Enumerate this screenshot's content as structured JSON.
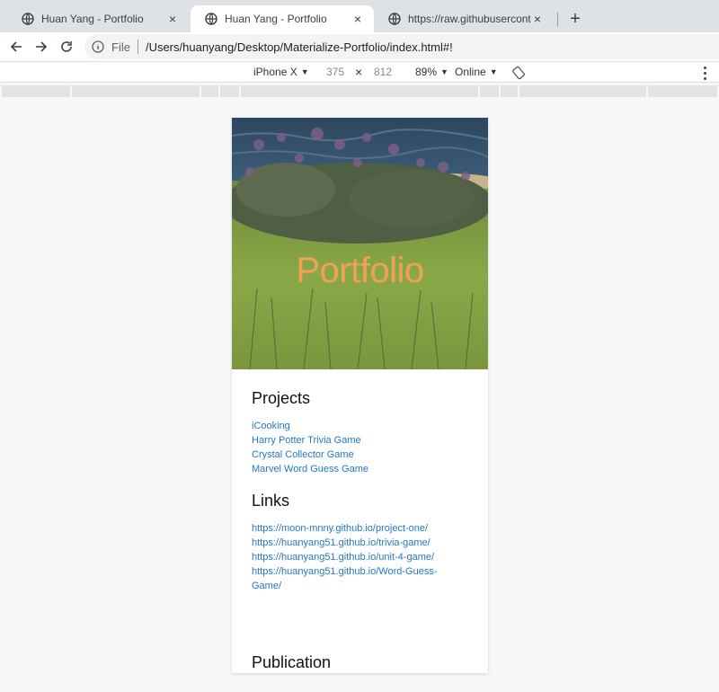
{
  "browser": {
    "tabs": [
      {
        "title": "Huan Yang - Portfolio",
        "close": "×"
      },
      {
        "title": "Huan Yang - Portfolio",
        "close": "×"
      },
      {
        "title": "https://raw.githubusercontent.c",
        "close": "×"
      }
    ],
    "new_tab": "+",
    "address": {
      "scheme": "File",
      "path": "/Users/huanyang/Desktop/Materialize-Portfolio/index.html#!"
    }
  },
  "devtools": {
    "device": "iPhone X",
    "width": "375",
    "times": "×",
    "height": "812",
    "zoom": "89%",
    "network": "Online"
  },
  "page": {
    "hero_title": "Portfolio",
    "projects": {
      "title": "Projects",
      "items": [
        "iCooking",
        "Harry Potter Trivia Game",
        "Crystal Collector Game",
        "Marvel Word Guess Game"
      ]
    },
    "links": {
      "title": "Links",
      "items": [
        "https://moon-mnny.github.io/project-one/",
        "https://huanyang51.github.io/trivia-game/",
        "https://huanyang51.github.io/unit-4-game/",
        "https://huanyang51.github.io/Word-Guess-Game/"
      ]
    },
    "publication": {
      "title": "Publication"
    }
  },
  "colors": {
    "link": "#1f78c8",
    "hero_text": "#f1a153",
    "tab_strip": "#dee1e6"
  }
}
